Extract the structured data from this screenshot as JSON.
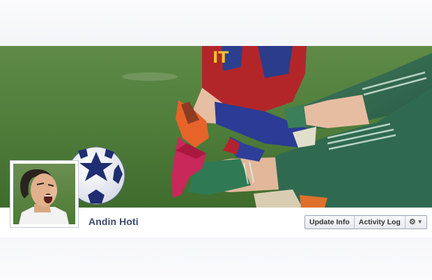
{
  "profile": {
    "name": "Andin Hoti"
  },
  "actions": {
    "update_info": "Update Info",
    "activity_log": "Activity Log",
    "settings_icon": "gear-icon",
    "dropdown_icon": "caret-down-icon"
  },
  "cover": {
    "jersey_text": "IT"
  },
  "colors": {
    "pitch": "#4d7a35",
    "name_text": "#3b4a6b",
    "border": "#9aa4b4"
  }
}
